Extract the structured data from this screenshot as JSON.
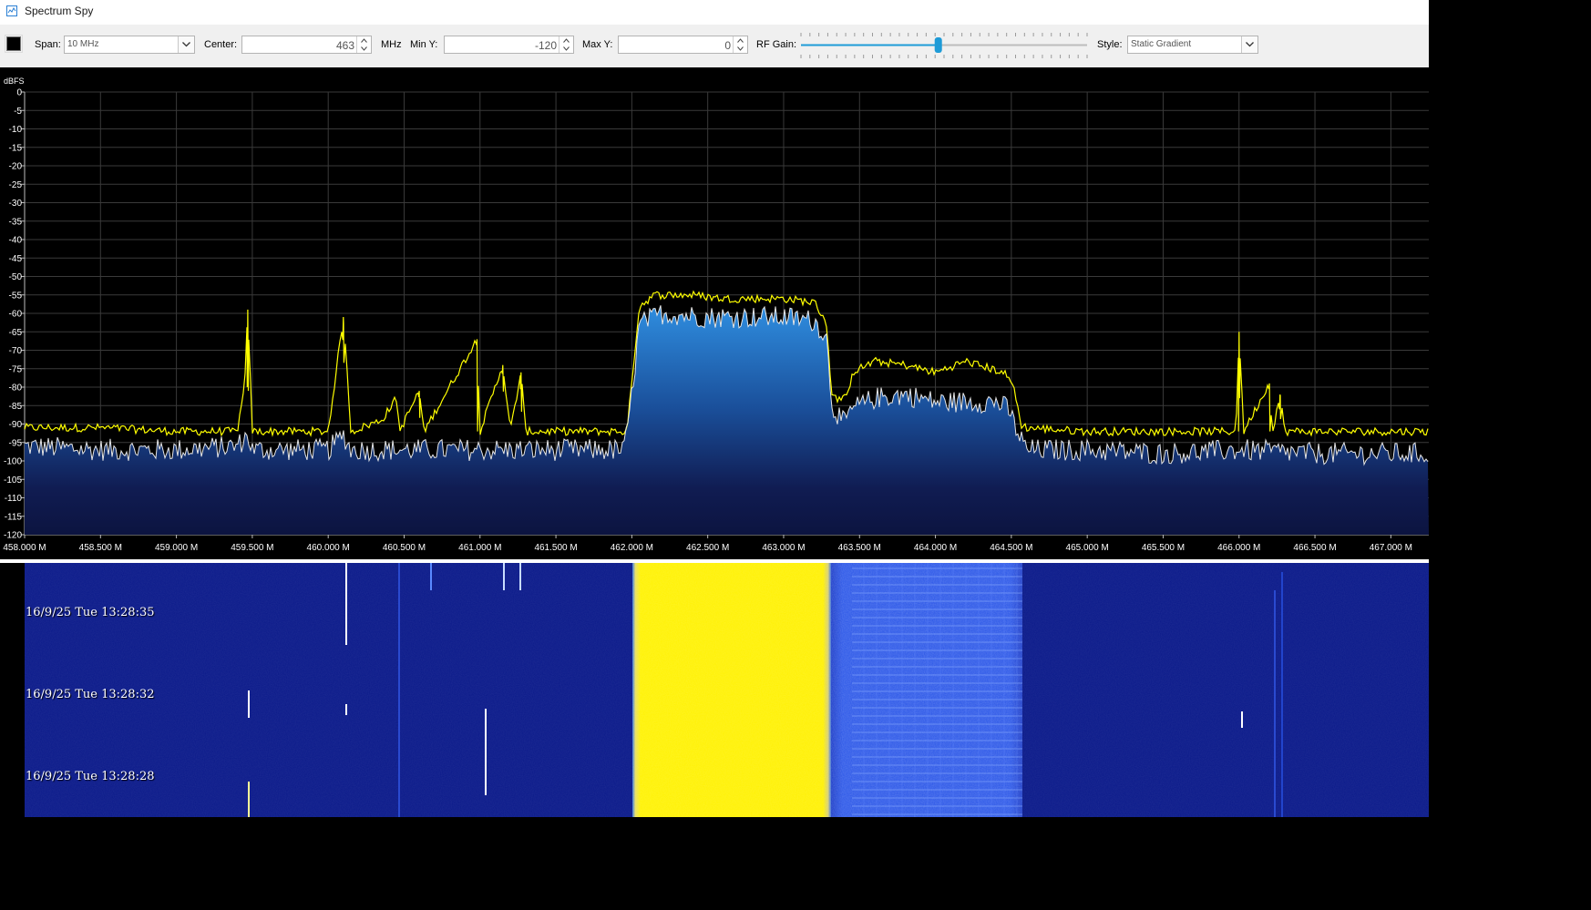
{
  "window": {
    "title": "Spectrum Spy"
  },
  "toolbar": {
    "span_label": "Span:",
    "span_value": "10 MHz",
    "center_label": "Center:",
    "center_value": "463",
    "center_unit": "MHz",
    "min_y_label": "Min Y:",
    "min_y_value": "-120",
    "max_y_label": "Max Y:",
    "max_y_value": "0",
    "rf_gain_label": "RF Gain:",
    "rf_gain_level": 0.48,
    "style_label": "Style:",
    "style_value": "Static Gradient",
    "colors": {
      "trace_color": "#000000",
      "slider_accent": "#1e9bd7"
    }
  },
  "waterfall": {
    "timestamps": [
      "16/9/25 Tue 13:28:35",
      "16/9/25 Tue 13:28:32",
      "16/9/25 Tue 13:28:28"
    ]
  },
  "chart_data": {
    "type": "area",
    "ylabel": "dBFS",
    "xlim": [
      458.0,
      467.25
    ],
    "ylim": [
      -120,
      0
    ],
    "grid": true,
    "x_ticks": [
      "458.000 M",
      "458.500 M",
      "459.000 M",
      "459.500 M",
      "460.000 M",
      "460.500 M",
      "461.000 M",
      "461.500 M",
      "462.000 M",
      "462.500 M",
      "463.000 M",
      "463.500 M",
      "464.000 M",
      "464.500 M",
      "465.000 M",
      "465.500 M",
      "466.000 M",
      "466.500 M",
      "467.000 M"
    ],
    "y_ticks": [
      0,
      -5,
      -10,
      -15,
      -20,
      -25,
      -30,
      -35,
      -40,
      -45,
      -50,
      -55,
      -60,
      -65,
      -70,
      -75,
      -80,
      -85,
      -90,
      -95,
      -100,
      -105,
      -110,
      -115,
      -120
    ],
    "series": [
      {
        "kind": "live",
        "color": "#e6e6e6",
        "points": [
          [
            458.0,
            -96
          ],
          [
            458.5,
            -97
          ],
          [
            459.0,
            -97
          ],
          [
            459.4,
            -96
          ],
          [
            459.47,
            -93
          ],
          [
            459.5,
            -97
          ],
          [
            460.0,
            -97
          ],
          [
            460.1,
            -93
          ],
          [
            460.15,
            -97
          ],
          [
            460.5,
            -97
          ],
          [
            461.0,
            -97
          ],
          [
            461.5,
            -97
          ],
          [
            461.95,
            -97
          ],
          [
            462.0,
            -82
          ],
          [
            462.05,
            -63
          ],
          [
            462.2,
            -60
          ],
          [
            462.5,
            -61
          ],
          [
            462.8,
            -61
          ],
          [
            463.0,
            -61
          ],
          [
            463.2,
            -62
          ],
          [
            463.28,
            -66
          ],
          [
            463.32,
            -85
          ],
          [
            463.4,
            -90
          ],
          [
            463.45,
            -86
          ],
          [
            463.6,
            -83
          ],
          [
            463.8,
            -82
          ],
          [
            464.0,
            -84
          ],
          [
            464.2,
            -84
          ],
          [
            464.4,
            -84
          ],
          [
            464.48,
            -86
          ],
          [
            464.55,
            -93
          ],
          [
            464.6,
            -97
          ],
          [
            465.0,
            -97
          ],
          [
            465.5,
            -98
          ],
          [
            466.0,
            -97
          ],
          [
            466.5,
            -98
          ],
          [
            467.0,
            -98
          ],
          [
            467.25,
            -98
          ]
        ]
      },
      {
        "kind": "peak-hold",
        "color": "#ffff00",
        "points": [
          [
            458.0,
            -91
          ],
          [
            458.5,
            -91
          ],
          [
            459.0,
            -92
          ],
          [
            459.4,
            -92
          ],
          [
            459.45,
            -80
          ],
          [
            459.47,
            -59
          ],
          [
            459.5,
            -92
          ],
          [
            460.0,
            -92
          ],
          [
            460.1,
            -61
          ],
          [
            460.15,
            -92
          ],
          [
            460.35,
            -89
          ],
          [
            460.45,
            -83
          ],
          [
            460.47,
            -92
          ],
          [
            460.6,
            -81
          ],
          [
            460.63,
            -92
          ],
          [
            460.98,
            -67
          ],
          [
            461.0,
            -92
          ],
          [
            461.15,
            -74
          ],
          [
            461.2,
            -92
          ],
          [
            461.27,
            -76
          ],
          [
            461.3,
            -92
          ],
          [
            461.5,
            -92
          ],
          [
            461.97,
            -92
          ],
          [
            462.0,
            -78
          ],
          [
            462.05,
            -58
          ],
          [
            462.15,
            -55
          ],
          [
            462.4,
            -55
          ],
          [
            462.6,
            -56
          ],
          [
            462.8,
            -56
          ],
          [
            463.0,
            -56
          ],
          [
            463.2,
            -57
          ],
          [
            463.28,
            -62
          ],
          [
            463.32,
            -83
          ],
          [
            463.42,
            -83
          ],
          [
            463.45,
            -76
          ],
          [
            463.6,
            -73
          ],
          [
            463.8,
            -74
          ],
          [
            464.0,
            -76
          ],
          [
            464.2,
            -73
          ],
          [
            464.45,
            -76
          ],
          [
            464.52,
            -80
          ],
          [
            464.56,
            -90
          ],
          [
            464.6,
            -91
          ],
          [
            465.0,
            -92
          ],
          [
            465.5,
            -92
          ],
          [
            465.98,
            -92
          ],
          [
            466.0,
            -65
          ],
          [
            466.03,
            -92
          ],
          [
            466.2,
            -79
          ],
          [
            466.22,
            -92
          ],
          [
            466.27,
            -82
          ],
          [
            466.3,
            -92
          ],
          [
            466.5,
            -92
          ],
          [
            467.0,
            -92
          ],
          [
            467.25,
            -92
          ]
        ]
      }
    ]
  }
}
